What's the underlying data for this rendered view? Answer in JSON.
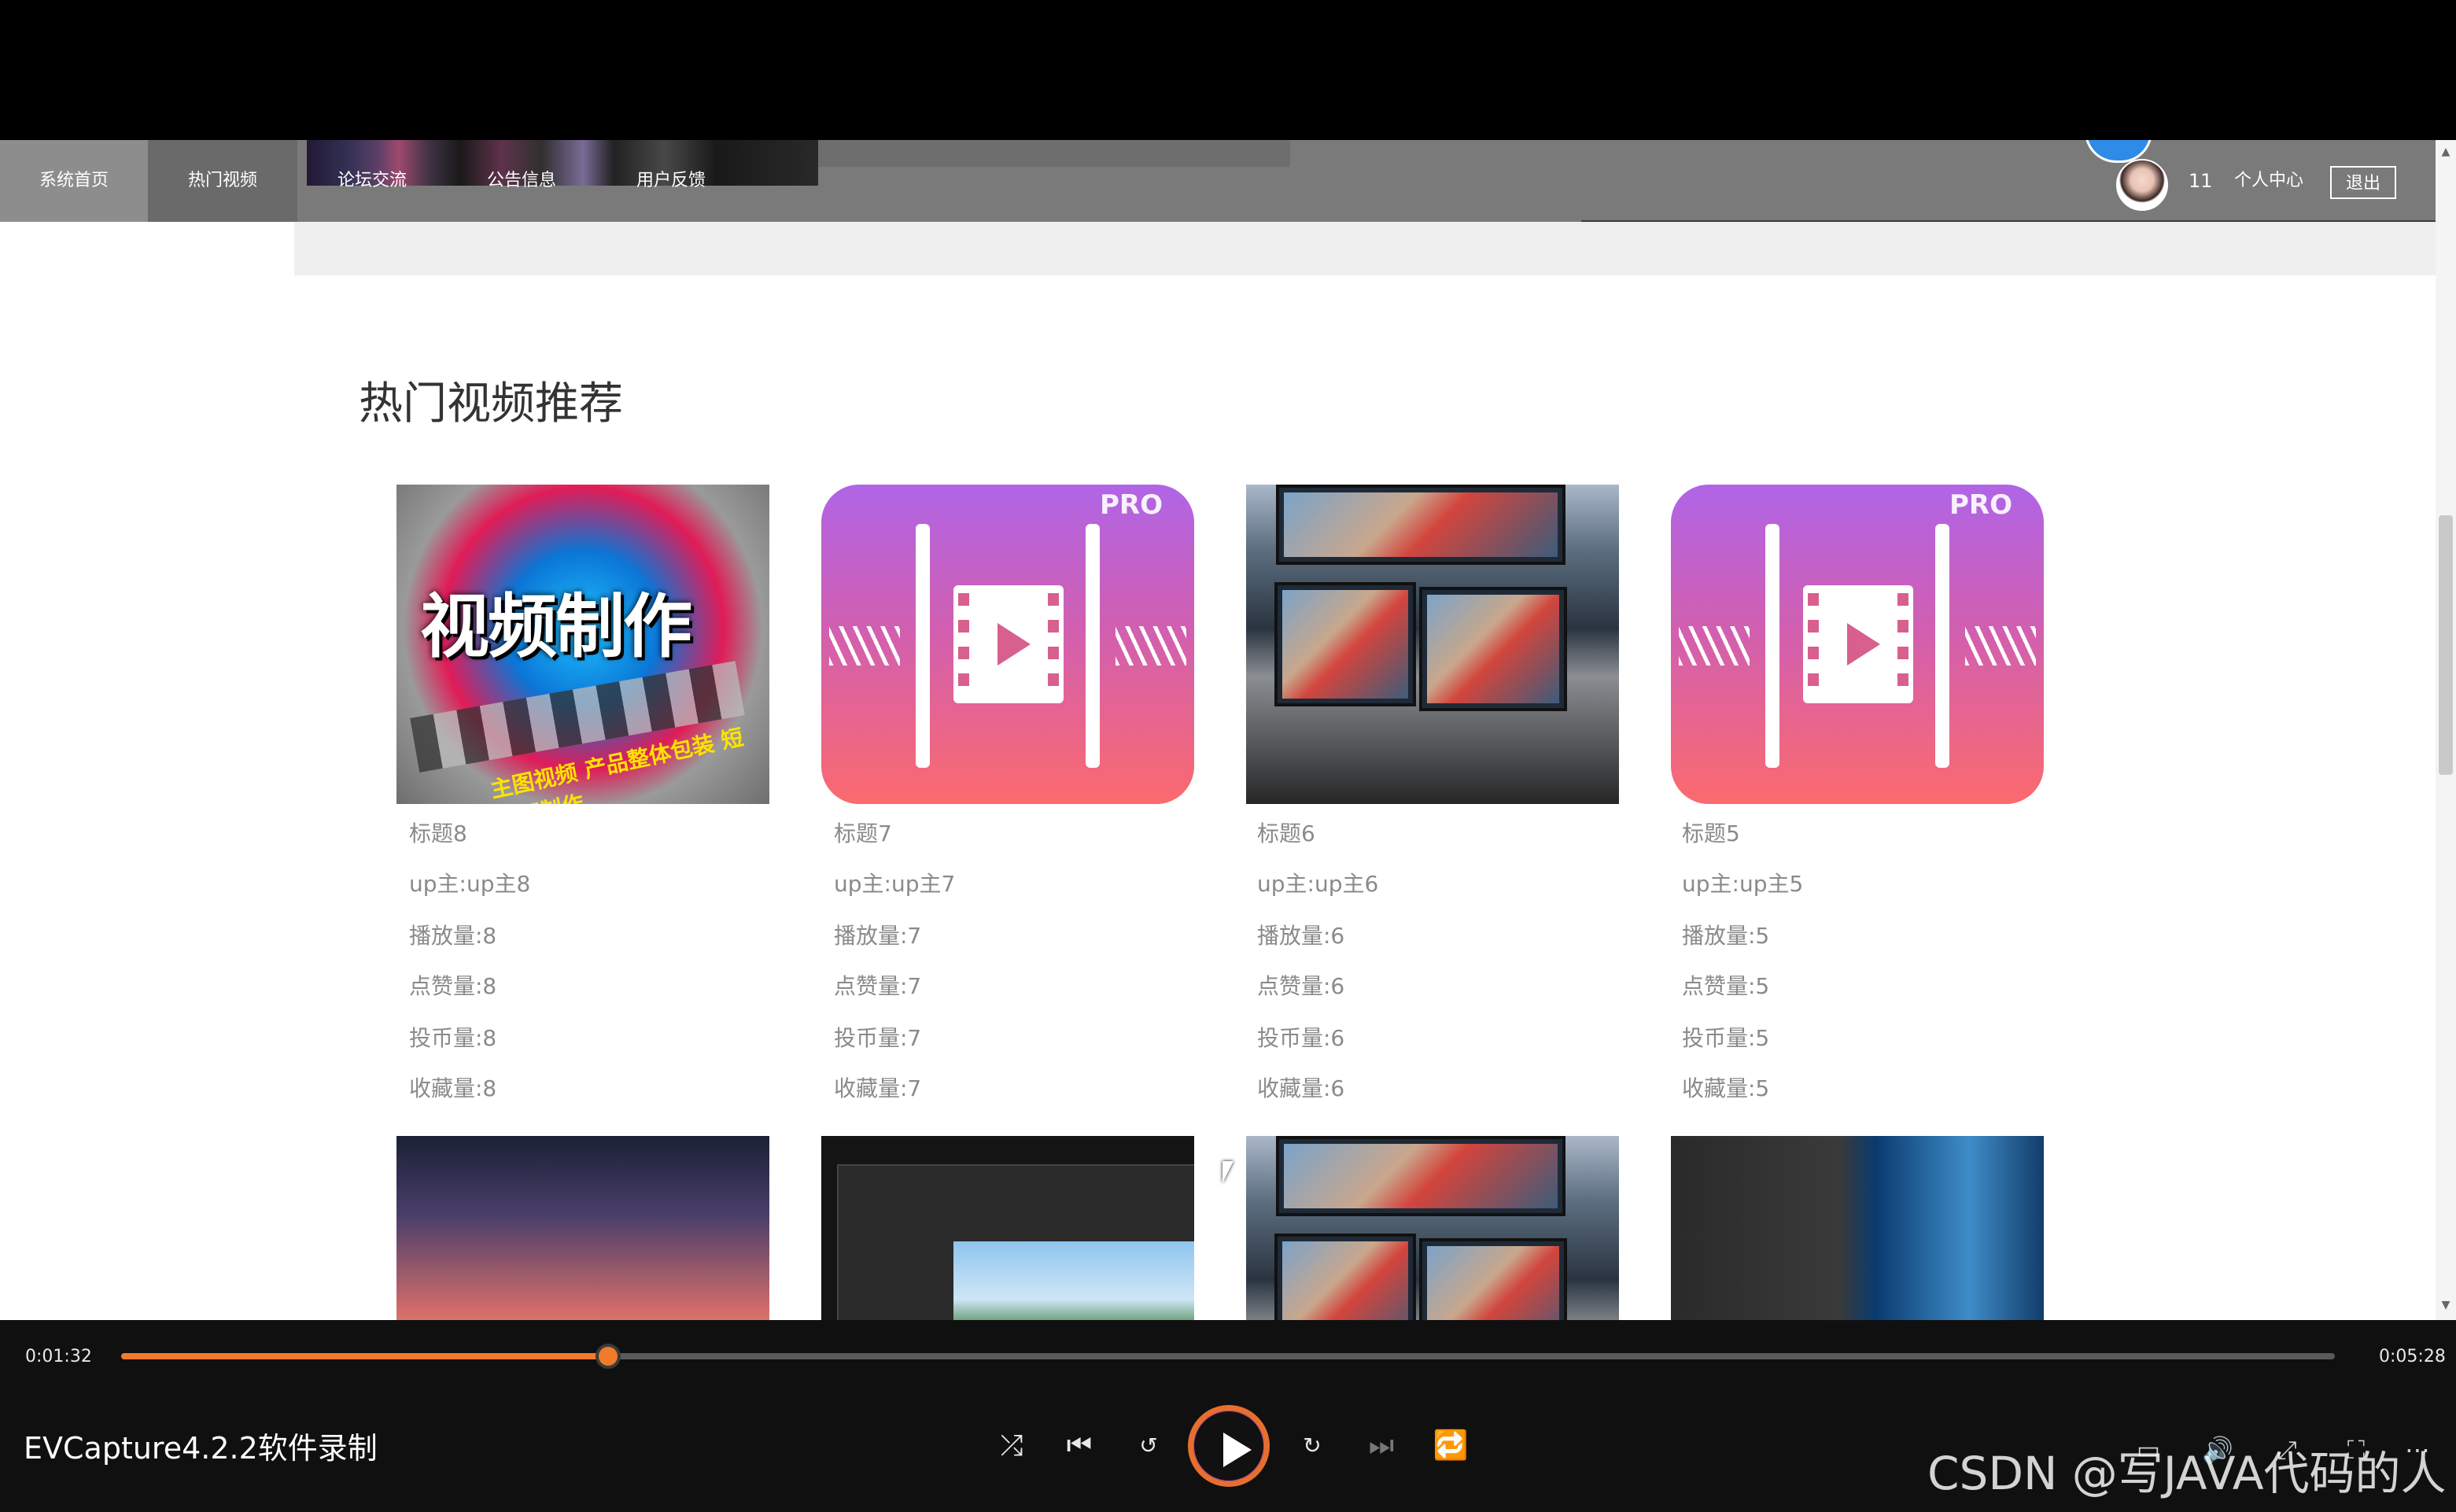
{
  "nav": {
    "items": [
      {
        "key": "home",
        "label": "系统首页"
      },
      {
        "key": "hot",
        "label": "热门视频"
      },
      {
        "key": "forum",
        "label": "论坛交流"
      },
      {
        "key": "notice",
        "label": "公告信息"
      },
      {
        "key": "feedback",
        "label": "用户反馈"
      }
    ],
    "user_name": "11",
    "user_center_label": "个人中心",
    "logout_label": "退出"
  },
  "section": {
    "title": "热门视频推荐"
  },
  "videos_row1": [
    {
      "title": "标题8",
      "up": "up主:up主8",
      "plays": "播放量:8",
      "likes": "点赞量:8",
      "coins": "投币量:8",
      "favs": "收藏量:8"
    },
    {
      "title": "标题7",
      "up": "up主:up主7",
      "plays": "播放量:7",
      "likes": "点赞量:7",
      "coins": "投币量:7",
      "favs": "收藏量:7"
    },
    {
      "title": "标题6",
      "up": "up主:up主6",
      "plays": "播放量:6",
      "likes": "点赞量:6",
      "coins": "投币量:6",
      "favs": "收藏量:6"
    },
    {
      "title": "标题5",
      "up": "up主:up主5",
      "plays": "播放量:5",
      "likes": "点赞量:5",
      "coins": "投币量:5",
      "favs": "收藏量:5"
    }
  ],
  "thumb_text": {
    "promo_main": "视频制作",
    "promo_sub": "主图视频 产品整体包装 短视频制作",
    "pro_label": "PRO"
  },
  "player": {
    "current_time": "0:01:32",
    "total_time": "0:05:28",
    "progress": 0.22,
    "title": "EVCapture4.2.2软件录制",
    "accent_color": "#f07c2a"
  },
  "watermark": "CSDN @写JAVA代码的人"
}
